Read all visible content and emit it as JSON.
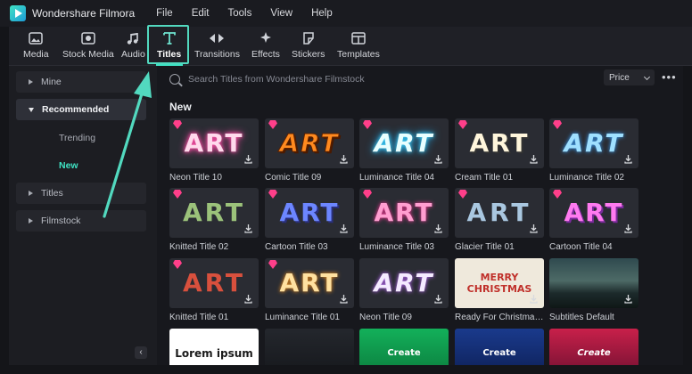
{
  "app": {
    "title": "Wondershare Filmora"
  },
  "menu": [
    "File",
    "Edit",
    "Tools",
    "View",
    "Help"
  ],
  "toolbar": {
    "tabs": [
      {
        "label": "Media",
        "icon": "image-icon"
      },
      {
        "label": "Stock Media",
        "icon": "cloud-image-icon"
      },
      {
        "label": "Audio",
        "icon": "music-note-icon"
      },
      {
        "label": "Titles",
        "icon": "text-t-icon",
        "active": true
      },
      {
        "label": "Transitions",
        "icon": "transition-icon"
      },
      {
        "label": "Effects",
        "icon": "sparkle-icon"
      },
      {
        "label": "Stickers",
        "icon": "sticker-icon"
      },
      {
        "label": "Templates",
        "icon": "template-icon"
      }
    ]
  },
  "sidebar": {
    "mine": "Mine",
    "recommended": "Recommended",
    "trending": "Trending",
    "new": "New",
    "titles": "Titles",
    "filmstock": "Filmstock",
    "collapse": "‹"
  },
  "search": {
    "placeholder": "Search Titles from Wondershare Filmstock"
  },
  "filter": {
    "price": "Price",
    "more": "•••"
  },
  "section": {
    "title": "New"
  },
  "grid": [
    {
      "name": "Neon Title 10",
      "art": "ART",
      "style": "neon-pink"
    },
    {
      "name": "Comic Title 09",
      "art": "ART",
      "style": "comic"
    },
    {
      "name": "Luminance Title 04",
      "art": "ART",
      "style": "lum-cyan"
    },
    {
      "name": "Cream Title 01",
      "art": "ART",
      "style": "cream"
    },
    {
      "name": "Luminance Title 02",
      "art": "ART",
      "style": "lum-blue"
    },
    {
      "name": "Knitted Title 02",
      "art": "ART",
      "style": "knit-green"
    },
    {
      "name": "Cartoon Title 03",
      "art": "ART",
      "style": "cartoon-blue"
    },
    {
      "name": "Luminance Title 03",
      "art": "ART",
      "style": "lum-pink"
    },
    {
      "name": "Glacier Title 01",
      "art": "ART",
      "style": "glacier"
    },
    {
      "name": "Cartoon Title 04",
      "art": "ART",
      "style": "cartoon-pink"
    },
    {
      "name": "Knitted Title 01",
      "art": "ART",
      "style": "knit-red"
    },
    {
      "name": "Luminance Title 01",
      "art": "ART",
      "style": "lum-gold"
    },
    {
      "name": "Neon Title 09",
      "art": "ART",
      "style": "neon-white"
    },
    {
      "name": "Ready For Christmas ...",
      "art": "MERRY CHRISTMAS",
      "style": "christmas"
    },
    {
      "name": "Subtitles Default",
      "art": "",
      "style": "landscape"
    },
    {
      "name": "",
      "art": "Lorem ipsum",
      "style": "lorem"
    },
    {
      "name": "",
      "art": "",
      "style": "dark-scene"
    },
    {
      "name": "",
      "art": "Create",
      "style": "create-green"
    },
    {
      "name": "",
      "art": "Create",
      "style": "create-blue"
    },
    {
      "name": "",
      "art": "Create",
      "style": "create-red"
    }
  ],
  "colors": {
    "accent": "#3fe3c4",
    "premium": "#ff3f8a"
  }
}
